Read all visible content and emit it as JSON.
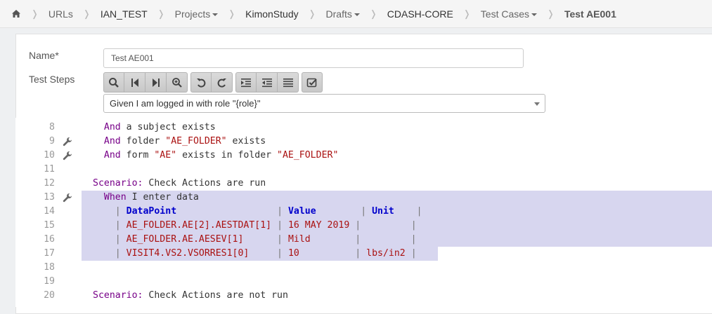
{
  "breadcrumb": {
    "items": [
      {
        "label": "URLs",
        "type": "link"
      },
      {
        "label": "IAN_TEST",
        "type": "strong"
      },
      {
        "label": "Projects",
        "type": "dropdown"
      },
      {
        "label": "KimonStudy",
        "type": "strong"
      },
      {
        "label": "Drafts",
        "type": "dropdown"
      },
      {
        "label": "CDASH-CORE",
        "type": "strong"
      },
      {
        "label": "Test Cases",
        "type": "dropdown"
      },
      {
        "label": "Test AE001",
        "type": "current"
      }
    ]
  },
  "form": {
    "name_label": "Name*",
    "name_value": "Test AE001",
    "steps_label": "Test Steps",
    "step_select_value": "Given I am logged in with role \"{role}\""
  },
  "toolbar": {
    "groups": [
      [
        "search-icon",
        "first-icon",
        "last-icon",
        "zoom-in-icon"
      ],
      [
        "undo-icon",
        "redo-icon"
      ],
      [
        "indent-icon",
        "outdent-icon",
        "format-icon"
      ],
      [
        "check-icon"
      ]
    ]
  },
  "editor": {
    "lines": [
      {
        "num": "8",
        "wrench": false,
        "tokens": [
          {
            "t": "  "
          },
          {
            "t": "And",
            "c": "kw"
          },
          {
            "t": " a subject exists"
          }
        ]
      },
      {
        "num": "9",
        "wrench": true,
        "tokens": [
          {
            "t": "  "
          },
          {
            "t": "And",
            "c": "kw"
          },
          {
            "t": " folder "
          },
          {
            "t": "\"AE_FOLDER\"",
            "c": "str"
          },
          {
            "t": " exists"
          }
        ]
      },
      {
        "num": "10",
        "wrench": true,
        "tokens": [
          {
            "t": "  "
          },
          {
            "t": "And",
            "c": "kw"
          },
          {
            "t": " form "
          },
          {
            "t": "\"AE\"",
            "c": "str"
          },
          {
            "t": " exists in folder "
          },
          {
            "t": "\"AE_FOLDER\"",
            "c": "str"
          }
        ]
      },
      {
        "num": "11",
        "wrench": false,
        "tokens": []
      },
      {
        "num": "12",
        "wrench": false,
        "tokens": [
          {
            "t": "Scenario:",
            "c": "kw"
          },
          {
            "t": " Check Actions are run"
          }
        ]
      },
      {
        "num": "13",
        "wrench": true,
        "sel": "full",
        "tokens": [
          {
            "t": "  "
          },
          {
            "t": "When",
            "c": "kw"
          },
          {
            "t": " I enter data"
          }
        ]
      },
      {
        "num": "14",
        "wrench": false,
        "sel": "full",
        "tokens": [
          {
            "t": "    "
          },
          {
            "t": "|",
            "c": "pipe"
          },
          {
            "t": " "
          },
          {
            "t": "DataPoint",
            "c": "hdr"
          },
          {
            "t": "                  "
          },
          {
            "t": "|",
            "c": "pipe"
          },
          {
            "t": " "
          },
          {
            "t": "Value",
            "c": "hdr"
          },
          {
            "t": "        "
          },
          {
            "t": "|",
            "c": "pipe"
          },
          {
            "t": " "
          },
          {
            "t": "Unit",
            "c": "hdr"
          },
          {
            "t": "    "
          },
          {
            "t": "|",
            "c": "pipe"
          }
        ]
      },
      {
        "num": "15",
        "wrench": false,
        "sel": "full",
        "tokens": [
          {
            "t": "    "
          },
          {
            "t": "|",
            "c": "pipe"
          },
          {
            "t": " "
          },
          {
            "t": "AE_FOLDER.AE[2].AESTDAT[1]",
            "c": "val"
          },
          {
            "t": " "
          },
          {
            "t": "|",
            "c": "pipe"
          },
          {
            "t": " "
          },
          {
            "t": "16 MAY 2019",
            "c": "val"
          },
          {
            "t": " "
          },
          {
            "t": "|",
            "c": "pipe"
          },
          {
            "t": "         "
          },
          {
            "t": "|",
            "c": "pipe"
          }
        ]
      },
      {
        "num": "16",
        "wrench": false,
        "sel": "full",
        "tokens": [
          {
            "t": "    "
          },
          {
            "t": "|",
            "c": "pipe"
          },
          {
            "t": " "
          },
          {
            "t": "AE_FOLDER.AE.AESEV[1]",
            "c": "val"
          },
          {
            "t": "      "
          },
          {
            "t": "|",
            "c": "pipe"
          },
          {
            "t": " "
          },
          {
            "t": "Mild",
            "c": "val"
          },
          {
            "t": "        "
          },
          {
            "t": "|",
            "c": "pipe"
          },
          {
            "t": "         "
          },
          {
            "t": "|",
            "c": "pipe"
          }
        ]
      },
      {
        "num": "17",
        "wrench": false,
        "sel": "partial",
        "tokens": [
          {
            "t": "    "
          },
          {
            "t": "|",
            "c": "pipe"
          },
          {
            "t": " "
          },
          {
            "t": "VISIT4.VS2.VSORRES1[0]",
            "c": "val"
          },
          {
            "t": "     "
          },
          {
            "t": "|",
            "c": "pipe"
          },
          {
            "t": " "
          },
          {
            "t": "10",
            "c": "val"
          },
          {
            "t": "          "
          },
          {
            "t": "|",
            "c": "pipe"
          },
          {
            "t": " "
          },
          {
            "t": "lbs/in2",
            "c": "val"
          },
          {
            "t": " "
          },
          {
            "t": "|",
            "c": "pipe"
          }
        ]
      },
      {
        "num": "18",
        "wrench": false,
        "tokens": []
      },
      {
        "num": "19",
        "wrench": false,
        "tokens": []
      },
      {
        "num": "20",
        "wrench": false,
        "tokens": [
          {
            "t": "Scenario:",
            "c": "kw"
          },
          {
            "t": " Check Actions are not run"
          }
        ]
      }
    ]
  },
  "colors": {
    "selection": "#d7d6ef",
    "keyword": "#770088",
    "string": "#aa1111",
    "table_header": "#0000cc"
  }
}
